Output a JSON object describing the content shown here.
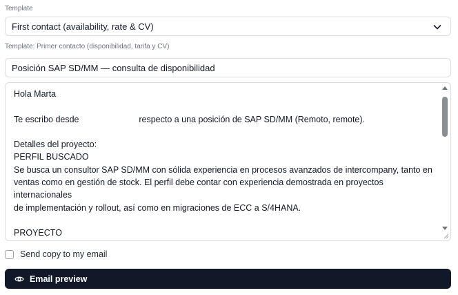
{
  "template": {
    "label": "Template",
    "selected": "First contact (availability, rate & CV)",
    "caption": "Template: Primer contacto (disponibilidad, tarifa y CV)"
  },
  "subject": {
    "value": "Posición SAP SD/MM — consulta de disponibilidad"
  },
  "body": {
    "text": "Hola Marta\n\nTe escribo desde                         respecto a una posición de SAP SD/MM (Remoto, remote).\n\nDetalles del proyecto:\nPERFIL BUSCADO\nSe busca un consultor SAP SD/MM con sólida experiencia en procesos avanzados de intercompany, tanto en\nventas como en gestión de stock. El perfil debe contar con experiencia demostrada en proyectos internacionales\nde implementación y rollout, así como en migraciones de ECC a S/4HANA.\n\nPROYECTO\nEl consultor se incorporará a un proyecto de transformación SAP con el cliente, cuyo objetivo principal es la"
  },
  "send_copy": {
    "label": "Send copy to my email",
    "checked": false
  },
  "preview_button": {
    "label": "Email preview",
    "icon": "eye-icon"
  },
  "colors": {
    "button_bg": "#111827",
    "border": "#d9dde3",
    "caption": "#6b7280"
  }
}
